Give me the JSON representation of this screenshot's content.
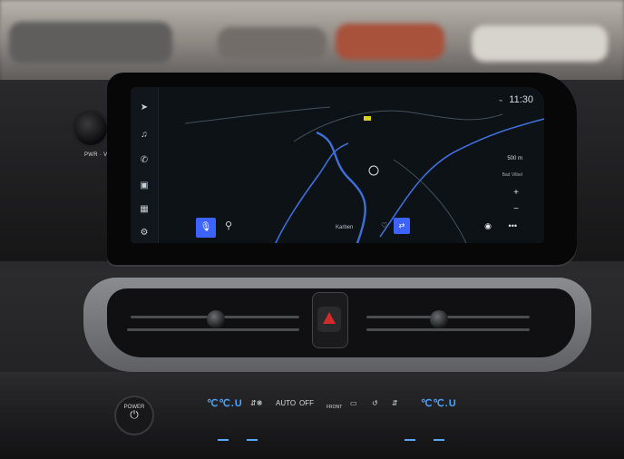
{
  "screen": {
    "status_time": "11:30",
    "scale_label": "500 m",
    "zoom_in": "+",
    "zoom_out": "−",
    "place_label": "Karben",
    "map_labels": [
      "Bad Vilbel"
    ]
  },
  "dash": {
    "knob_label": "PWR · VOL",
    "power_label": "POWER"
  },
  "climate": {
    "left_temp": "℃℃.U",
    "right_temp": "℃℃.U",
    "auto_label": "AUTO",
    "off_label": "OFF",
    "front_label": "FRONT"
  },
  "colors": {
    "accent": "#3c63ff",
    "hazard": "#d42a2a",
    "climate_display": "#4aa3ff"
  },
  "icons": {
    "rail": [
      "navigation-icon",
      "music-icon",
      "phone-icon",
      "car-icon",
      "apps-icon",
      "settings-icon"
    ]
  }
}
